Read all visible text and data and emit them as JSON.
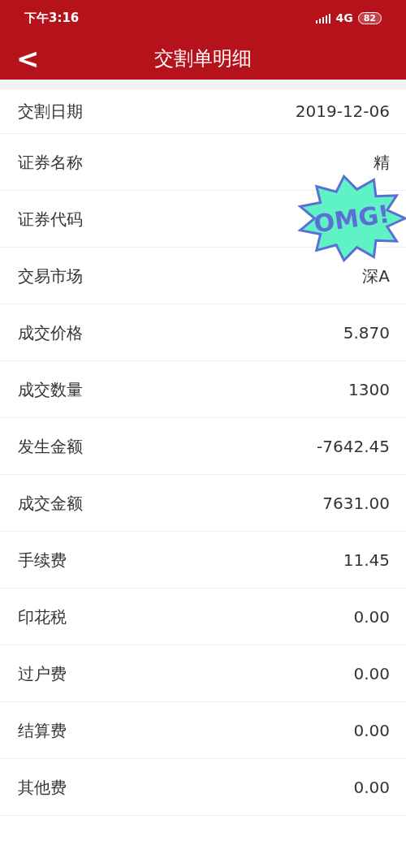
{
  "status_bar": {
    "time": "下午3:16",
    "network": "4G",
    "battery": "82"
  },
  "header": {
    "back": "<",
    "title": "交割单明细"
  },
  "rows": [
    {
      "label": "交割日期",
      "value": "2019-12-06"
    },
    {
      "label": "证券名称",
      "value": "精"
    },
    {
      "label": "证券代码"
    },
    {
      "label": "交易市场",
      "value": "深A"
    },
    {
      "label": "成交价格",
      "value": "5.870"
    },
    {
      "label": "成交数量",
      "value": "1300"
    },
    {
      "label": "发生金额",
      "value": "-7642.45"
    },
    {
      "label": "成交金额",
      "value": "7631.00"
    },
    {
      "label": "手续费",
      "value": "11.45"
    },
    {
      "label": "印花税",
      "value": "0.00"
    },
    {
      "label": "过户费",
      "value": "0.00"
    },
    {
      "label": "结算费",
      "value": "0.00"
    },
    {
      "label": "其他费",
      "value": "0.00"
    }
  ],
  "sticker": {
    "text": "OMG!"
  }
}
